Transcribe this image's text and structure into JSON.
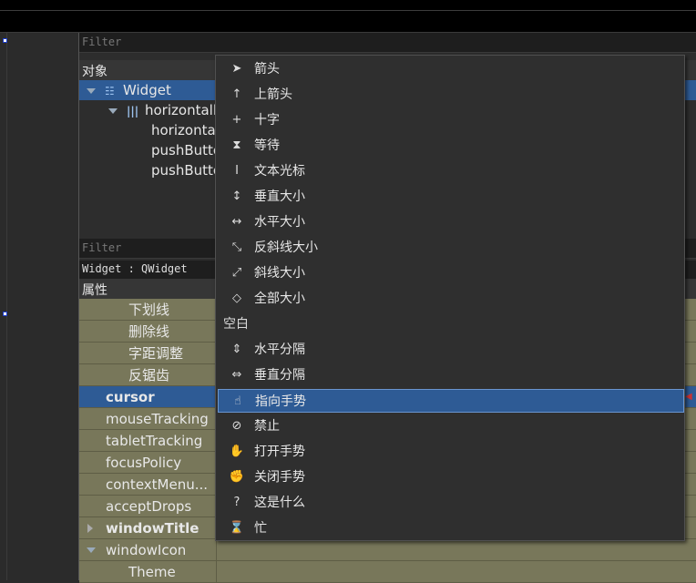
{
  "object_panel": {
    "filter_placeholder": "Filter",
    "header": "对象",
    "tree": [
      {
        "label": "Widget",
        "level": 0,
        "selected": true
      },
      {
        "label": "horizontall",
        "level": 1
      },
      {
        "label": "horizontal",
        "level": 2
      },
      {
        "label": "pushButto",
        "level": 2
      },
      {
        "label": "pushButto",
        "level": 2
      }
    ]
  },
  "property_panel": {
    "filter_placeholder": "Filter",
    "class_label": "Widget : QWidget",
    "header": "属性",
    "rows": [
      {
        "label": "下划线",
        "indent": 2
      },
      {
        "label": "删除线",
        "indent": 2
      },
      {
        "label": "字距调整",
        "indent": 2
      },
      {
        "label": "反锯齿",
        "indent": 2
      },
      {
        "label": "cursor",
        "indent": 1,
        "selected": true
      },
      {
        "label": "mouseTracking",
        "indent": 1
      },
      {
        "label": "tabletTracking",
        "indent": 1
      },
      {
        "label": "focusPolicy",
        "indent": 1
      },
      {
        "label": "contextMenu...",
        "indent": 1
      },
      {
        "label": "acceptDrops",
        "indent": 1
      },
      {
        "label": "windowTitle",
        "indent": 1,
        "bold": true,
        "expandable": true
      },
      {
        "label": "windowIcon",
        "indent": 1,
        "expanded": true
      },
      {
        "label": "Theme",
        "indent": 2
      }
    ]
  },
  "cursor_menu": {
    "items": [
      {
        "label": "箭头",
        "icon": "arrow-cursor-icon",
        "glyph": "➤"
      },
      {
        "label": "上箭头",
        "icon": "up-arrow-cursor-icon",
        "glyph": "↑"
      },
      {
        "label": "十字",
        "icon": "cross-cursor-icon",
        "glyph": "+"
      },
      {
        "label": "等待",
        "icon": "hourglass-cursor-icon",
        "glyph": "⧗"
      },
      {
        "label": "文本光标",
        "icon": "ibeam-cursor-icon",
        "glyph": "I"
      },
      {
        "label": "垂直大小",
        "icon": "resize-vertical-icon",
        "glyph": "↕"
      },
      {
        "label": "水平大小",
        "icon": "resize-horizontal-icon",
        "glyph": "↔"
      },
      {
        "label": "反斜线大小",
        "icon": "resize-backslash-icon",
        "glyph": "⤡"
      },
      {
        "label": "斜线大小",
        "icon": "resize-slash-icon",
        "glyph": "⤢"
      },
      {
        "label": "全部大小",
        "icon": "resize-all-icon",
        "glyph": "◇"
      },
      {
        "label": "空白",
        "header": true
      },
      {
        "label": "水平分隔",
        "icon": "split-horizontal-icon",
        "glyph": "⇕"
      },
      {
        "label": "垂直分隔",
        "icon": "split-vertical-icon",
        "glyph": "⇔"
      },
      {
        "label": "指向手势",
        "icon": "pointing-hand-icon",
        "glyph": "☝",
        "highlighted": true
      },
      {
        "label": "禁止",
        "icon": "forbidden-icon",
        "glyph": "⊘"
      },
      {
        "label": "打开手势",
        "icon": "open-hand-icon",
        "glyph": "✋"
      },
      {
        "label": "关闭手势",
        "icon": "closed-hand-icon",
        "glyph": "✊"
      },
      {
        "label": "这是什么",
        "icon": "whats-this-icon",
        "glyph": "?"
      },
      {
        "label": "忙",
        "icon": "busy-cursor-icon",
        "glyph": "⌛"
      }
    ]
  }
}
